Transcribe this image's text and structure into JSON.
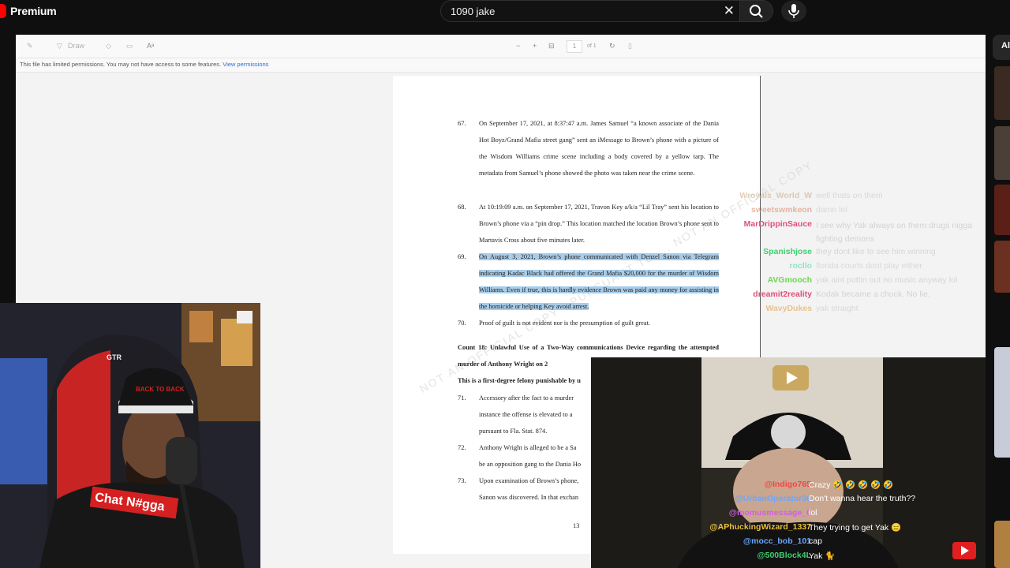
{
  "header": {
    "brand": "Premium",
    "search_query": "1090 jake",
    "clear_icon": "✕",
    "search_icon": "search-icon",
    "mic_icon": "mic-icon"
  },
  "viewer": {
    "toolbar": {
      "draw_label": "Draw",
      "page_value": "1",
      "page_total": "of 1"
    },
    "notice_text": "This file has limited permissions. You may not have access to some features.",
    "notice_link": "View permissions"
  },
  "document": {
    "paragraphs": [
      {
        "num": "67.",
        "text": "On September 17, 2021, at 8:37:47 a.m. James Samuel “a known associate of the Dania Hot Boyz/Grand Mafia street gang” sent an iMessage to Brown’s phone with a picture of the Wisdom Williams crime scene including a body covered by a yellow tarp. The metadata from Samuel’s phone showed the photo was taken near the crime scene.",
        "highlighted": false
      },
      {
        "num": "68.",
        "text": "At 10:19:09 a.m. on September 17, 2021, Travon Key a/k/a “Lil Tray” sent his location to Brown’s phone via a “pin drop.” This location matched the location Brown’s phone sent to Martavis Cross about five minutes later.",
        "highlighted": false
      },
      {
        "num": "69.",
        "text": "On August 3, 2021, Brown’s phone communicated with Denzel Sanon via Telegram indicating Kadac Black had offered the Grand Mafia $20,000 for the murder of Wisdom Williams. Even if true, this is hardly evidence Brown was paid any money for assisting in the homicide or helping Key avoid arrest.",
        "highlighted": true
      },
      {
        "num": "70.",
        "text": "Proof of guilt is not evident nor is the presumption of guilt great.",
        "highlighted": false
      }
    ],
    "count_heading": "Count 18: Unlawful Use of a Two-Way communications Device regarding the attempted murder of Anthony Wright on 2",
    "count_line3": "This is a first-degree felony punishable by u",
    "lower_paragraphs": [
      {
        "num": "71.",
        "lines": [
          "Accessory after the fact to a murder",
          "instance the offense is elevated to a",
          "pursuant to Fla. Stat. 874."
        ]
      },
      {
        "num": "72.",
        "lines": [
          "Anthony Wright is alleged to be a Sa",
          "be an opposition gang to the Dania Ho"
        ]
      },
      {
        "num": "73.",
        "lines": [
          "Upon examination of Brown’s phone,",
          "Sanon was discovered. In that exchan"
        ]
      }
    ],
    "page_number": "13",
    "watermark": "NOT AN OFFICIAL COPY - PURSUANT TO ... NOT AN OFFICIAL COPY"
  },
  "side": {
    "all_label": "All"
  },
  "chat_top": [
    {
      "user": "Wroyals_World_W",
      "msg": "well thats on them",
      "color": "#c8a878",
      "faded": true
    },
    {
      "user": "sweetswmkeon",
      "msg": "damn lol",
      "color": "#d98a6a",
      "faded": true
    },
    {
      "user": "MarDrippinSauce",
      "msg": "I see why Yak always on them drugs nigga fighting demons",
      "color": "#e0507a",
      "faded": false
    },
    {
      "user": "Spanishjose",
      "msg": "they dont like to see him winning",
      "color": "#3fcf6f",
      "faded": false
    },
    {
      "user": "rocllo",
      "msg": "florida courts dont play either",
      "color": "#4fd8a8",
      "faded": true
    },
    {
      "user": "AVGmooch",
      "msg": "yak aint puttin out no music anyway lol",
      "color": "#6cd84a",
      "faded": false
    },
    {
      "user": "dreamit2reality",
      "msg": "Kodak became a chuck. No lie.",
      "color": "#e0507a",
      "faded": false
    },
    {
      "user": "WavyDukes",
      "msg": "yak straight",
      "color": "#e09a3a",
      "faded": true
    }
  ],
  "chat_bottom": [
    {
      "user": "@Indigo765",
      "msg": "Crazy 🤣 🤣 🤣 🤣 🤣",
      "color": "#ff4040"
    },
    {
      "user": "@UrbanOperator36",
      "msg": "Don't wanna hear the truth??",
      "color": "#6aa6ff"
    },
    {
      "user": "@momusmessage_0",
      "msg": "lol",
      "color": "#d060e0"
    },
    {
      "user": "@APhuckingWizard_1337",
      "msg": "They trying to get Yak 😑",
      "color": "#e8c040"
    },
    {
      "user": "@mocc_bob_101",
      "msg": "cap",
      "color": "#6aa6ff"
    },
    {
      "user": "@500Block4L",
      "msg": "Yak 🐈",
      "color": "#3fcf6f"
    }
  ],
  "webcam_left": {
    "cap_text": "BACK TO BACK",
    "shirt_text": "Chat N#gga",
    "chair_text": "GTR"
  }
}
